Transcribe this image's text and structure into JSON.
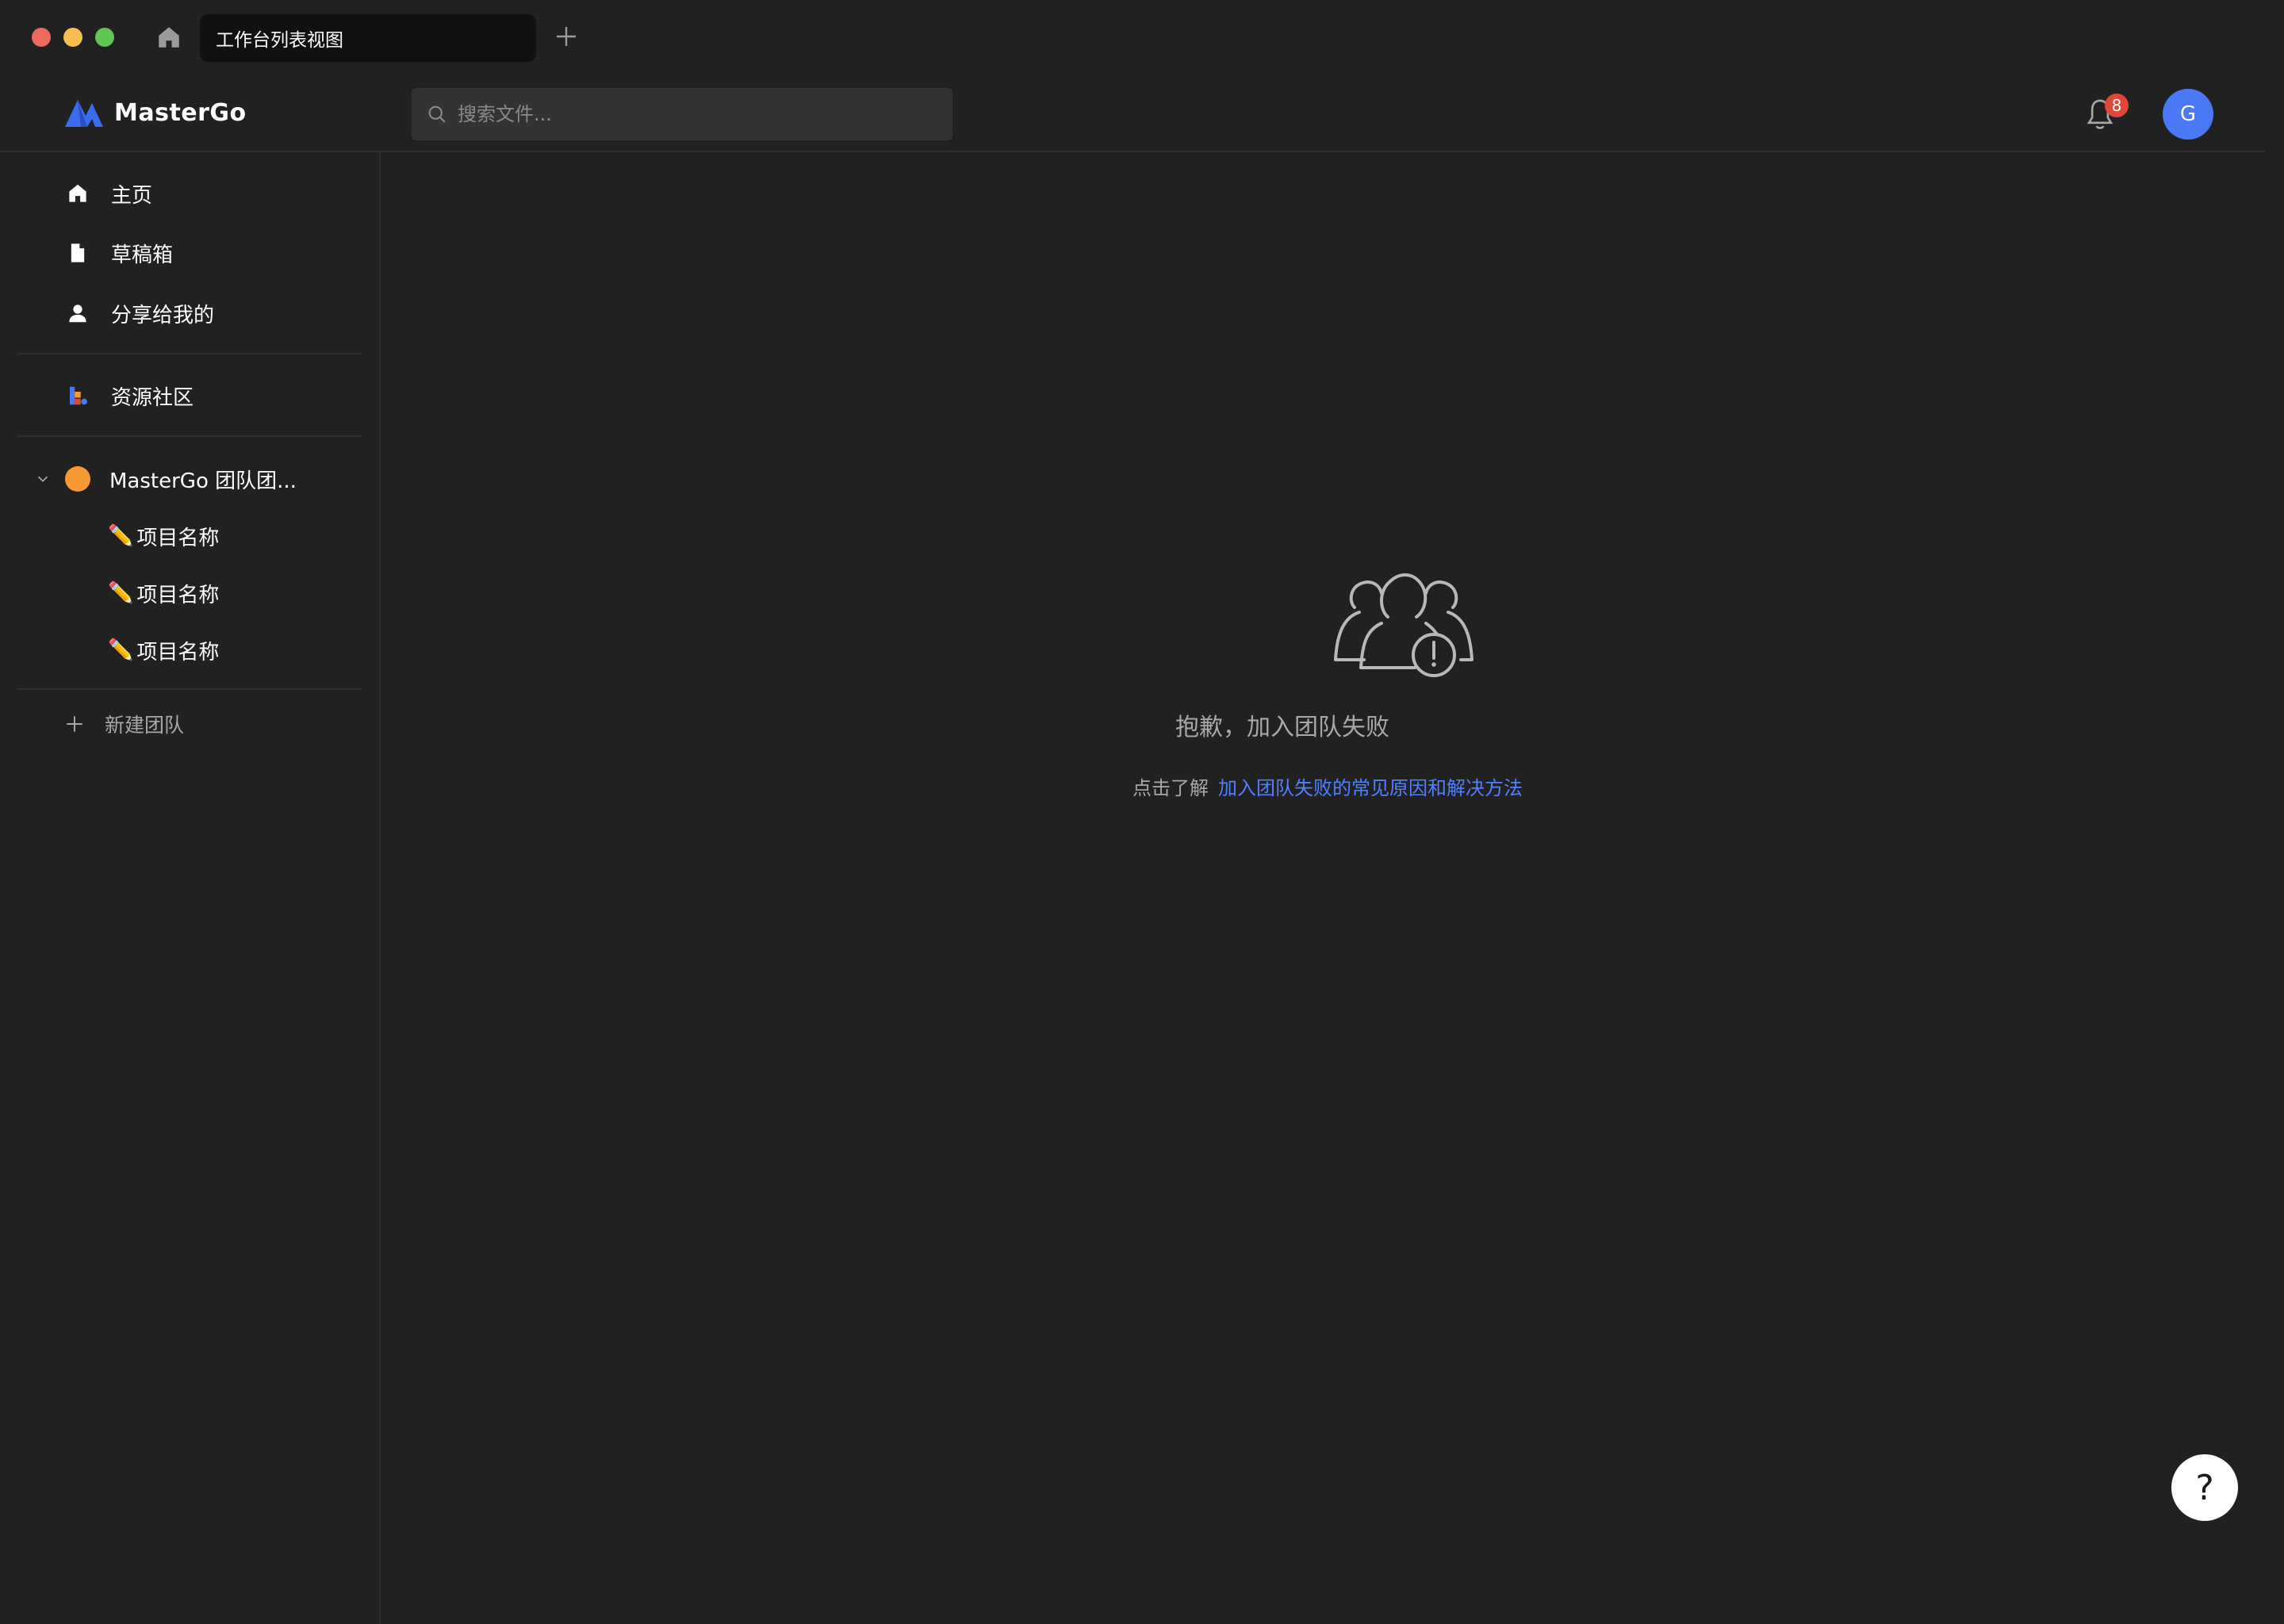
{
  "window": {
    "tab_title": "工作台列表视图"
  },
  "header": {
    "logo_text": "MasterGo",
    "search_placeholder": "搜索文件...",
    "notification_count": "8",
    "avatar_initial": "G"
  },
  "sidebar": {
    "nav": [
      {
        "label": "主页",
        "icon": "home-icon"
      },
      {
        "label": "草稿箱",
        "icon": "file-icon"
      },
      {
        "label": "分享给我的",
        "icon": "user-icon"
      }
    ],
    "community": {
      "label": "资源社区",
      "icon": "community-icon"
    },
    "team": {
      "name": "MasterGo 团队团...",
      "color": "#f79a35",
      "projects": [
        {
          "emoji": "✏️",
          "label": "项目名称"
        },
        {
          "emoji": "✏️",
          "label": "项目名称"
        },
        {
          "emoji": "✏️",
          "label": "项目名称"
        }
      ]
    },
    "new_team_label": "新建团队"
  },
  "empty_state": {
    "icon": "team-error-icon",
    "title": "抱歉，加入团队失败",
    "hint_prefix": "点击了解",
    "hint_link": "加入团队失败的常见原因和解决方法"
  },
  "help_label": "?",
  "colors": {
    "background": "#212121",
    "accent": "#4b78f5",
    "link": "#4f80ff",
    "badge": "#e0473b",
    "team_dot": "#f79a35"
  }
}
